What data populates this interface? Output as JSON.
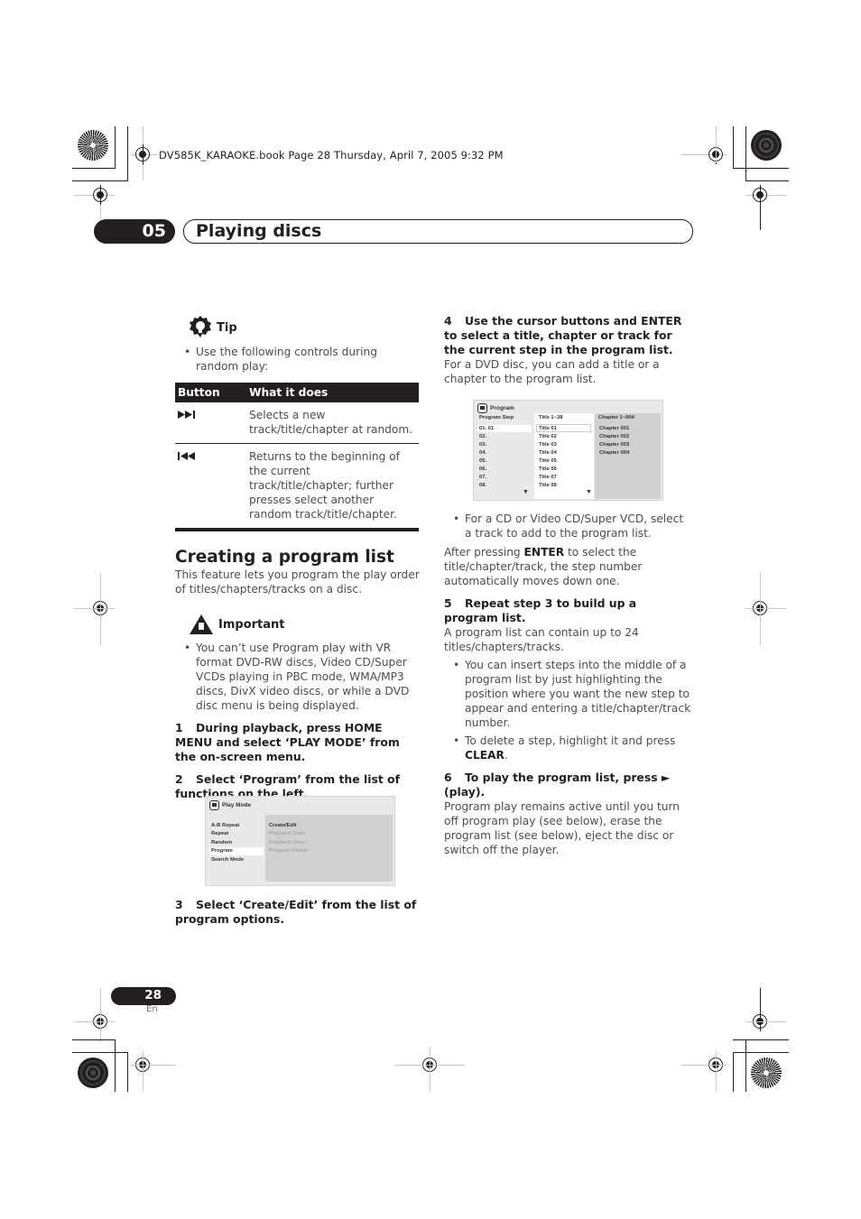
{
  "print_header": "DV585K_KARAOKE.book  Page 28  Thursday, April 7, 2005  9:32 PM",
  "chapter": {
    "number": "05",
    "title": "Playing discs"
  },
  "tip": {
    "label": "Tip",
    "icon": "lightbulb-icon",
    "bullet": "Use the following controls during random play:",
    "table": {
      "headers": [
        "Button",
        "What it does"
      ],
      "rows": [
        {
          "button": "⏭",
          "button_icon": "next-track-icon",
          "description": "Selects a new track/title/chapter at random."
        },
        {
          "button": "⏮",
          "button_icon": "previous-track-icon",
          "description": "Returns to the beginning of the current track/title/chapter; further presses select another random track/title/chapter."
        }
      ]
    }
  },
  "section": {
    "title": "Creating a program list",
    "intro": "This feature lets you program the play order of titles/chapters/tracks on a disc."
  },
  "important": {
    "label": "Important",
    "icon": "warning-icon",
    "bullet": "You can’t use Program play with VR format DVD-RW discs, Video CD/Super VCDs playing in PBC mode, WMA/MP3 discs, DivX video discs, or while a DVD disc menu is being displayed."
  },
  "steps": [
    {
      "num": "1",
      "head": "During playback, press HOME MENU and select ‘PLAY MODE’ from the on-screen menu."
    },
    {
      "num": "2",
      "head": "Select ‘Program’ from the list of functions on the left."
    },
    {
      "num": "3",
      "head": "Select ‘Create/Edit’ from the list of program options."
    },
    {
      "num": "4",
      "head": "Use the cursor buttons and ENTER to select a title, chapter or track for the current step in the program list.",
      "body": "For a DVD disc, you can add a title or a chapter to the program list."
    },
    {
      "num": "5",
      "head": "Repeat step 3 to build up a program list.",
      "body": "A program list can contain up to 24 titles/chapters/tracks."
    },
    {
      "num": "6",
      "head": "To play the program list, press ► (play).",
      "body": "Program play remains active until you turn off program play (see below), erase the program list (see below), eject the disc or switch off the player."
    }
  ],
  "step4_bullet": "For a CD or Video CD/Super VCD, select a track to add to the program list.",
  "after_enter": {
    "pre": "After pressing ",
    "key": "ENTER",
    "post": " to select the title/chapter/track, the step number automatically moves down one."
  },
  "step5_bullets": [
    {
      "text": "You can insert steps into the middle of a program list by just highlighting the position where you want the new step to appear and entering a title/chapter/track number."
    },
    {
      "pre": "To delete a step, highlight it and press ",
      "key": "CLEAR",
      "post": "."
    }
  ],
  "osd_play_mode": {
    "title": "Play Mode",
    "functions": [
      "A-B Repeat",
      "Repeat",
      "Random",
      "Program",
      "Search Mode"
    ],
    "selected_function": "Program",
    "options": [
      {
        "label": "Create/Edit",
        "enabled": true
      },
      {
        "label": "Playback Start",
        "enabled": false
      },
      {
        "label": "Playback Stop",
        "enabled": false
      },
      {
        "label": "Program Delete",
        "enabled": false
      }
    ]
  },
  "osd_program": {
    "title": "Program",
    "col_step": "Program Step",
    "col_title": "Title 1~38",
    "col_chapter": "Chapter 1~004",
    "steps": [
      "01. 01",
      "02.",
      "03.",
      "04.",
      "05.",
      "06.",
      "07.",
      "08."
    ],
    "titles": [
      "Title 01",
      "Title 02",
      "Title 03",
      "Title 04",
      "Title 05",
      "Title 06",
      "Title 07",
      "Title 08"
    ],
    "chapters": [
      "Chapter 001",
      "Chapter 002",
      "Chapter 003",
      "Chapter 004"
    ]
  },
  "footer": {
    "page": "28",
    "lang": "En"
  }
}
